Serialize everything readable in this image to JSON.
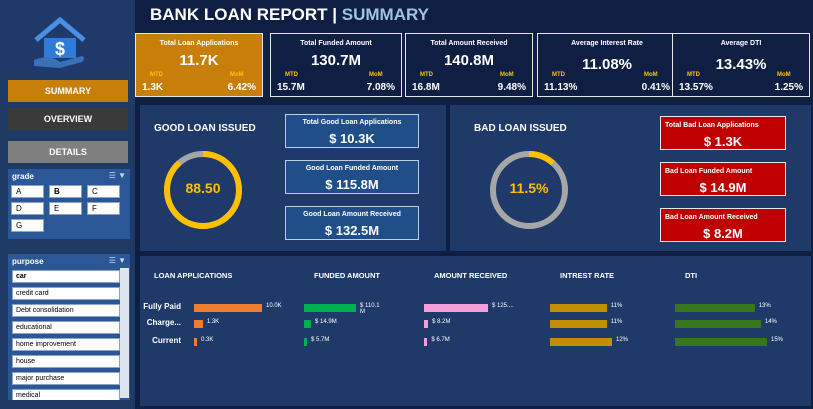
{
  "header": {
    "title": "BANK LOAN REPORT | ",
    "subtitle": "SUMMARY"
  },
  "icons": {
    "logo": "house-dollar-hand-icon",
    "filter": "filter-icon",
    "multiselect": "multi-select-icon"
  },
  "colors": {
    "accent": "#c87f0a",
    "kpi_gold": "#ffc000",
    "good": "#2e5fa0",
    "bad": "#c00000",
    "orange_bar": "#ed7d31",
    "green_bar": "#00b050",
    "pink_bar": "#f4a0d8",
    "gold_bar": "#bf8f00",
    "dti_bar": "#38761d"
  },
  "nav": {
    "summary": "SUMMARY",
    "overview": "OVERVIEW",
    "details": "DETAILS"
  },
  "grade": {
    "title": "grade",
    "options": [
      "A",
      "B",
      "C",
      "D",
      "E",
      "F",
      "G"
    ],
    "selected": "B"
  },
  "purpose": {
    "title": "purpose",
    "options": [
      "car",
      "credit card",
      "Debt consolidation",
      "educational",
      "home improvement",
      "house",
      "major purchase",
      "medical"
    ]
  },
  "kpis": [
    {
      "label": "Total Loan Applications",
      "value": "11.7K",
      "mtd_label": "MTD",
      "mom_label": "MoM",
      "mtd": "1.3K",
      "mom": "6.42%"
    },
    {
      "label": "Total Funded Amount",
      "value": "130.7M",
      "mtd_label": "MTD",
      "mom_label": "MoM",
      "mtd": "15.7M",
      "mom": "7.08%"
    },
    {
      "label": "Total Amount Received",
      "value": "140.8M",
      "mtd_label": "MTD",
      "mom_label": "MoM",
      "mtd": "16.8M",
      "mom": "9.48%"
    },
    {
      "label": "Average Interest Rate",
      "value": "11.08%",
      "mtd_label": "MTD",
      "mom_label": "MoM",
      "mtd": "11.13%",
      "mom": "0.41%"
    },
    {
      "label": "Average  DTI",
      "value": "13.43%",
      "mtd_label": "MTD",
      "mom_label": "MoM",
      "mtd": "13.57%",
      "mom": "1.25%"
    }
  ],
  "good": {
    "title": "GOOD LOAN ISSUED",
    "percent": "88.50",
    "fraction": 0.885,
    "cards": [
      {
        "label": "Total Good  Loan Applications",
        "value": "$ 10.3K"
      },
      {
        "label": "Good Loan Funded Amount",
        "value": "$ 115.8M"
      },
      {
        "label": "Good Loan  Amount Received",
        "value": "$ 132.5M"
      }
    ]
  },
  "bad": {
    "title": "BAD LOAN ISSUED",
    "percent": "11.5%",
    "fraction": 0.115,
    "cards": [
      {
        "label": "Total Bad  Loan Applications",
        "value": "$ 1.3K"
      },
      {
        "label": "Bad Loan Funded Amount",
        "value": "$ 14.9M"
      },
      {
        "label": "Bad Loan  Amount Received",
        "value": "$ 8.2M"
      }
    ]
  },
  "chart_data": [
    {
      "type": "bar",
      "title": "LOAN APPLICATIONS",
      "categories": [
        "Fully Paid",
        "Charge...",
        "Current"
      ],
      "values": [
        10.0,
        1.3,
        0.3
      ],
      "data_labels": [
        "10.0K",
        "1.3K",
        "0.3K"
      ]
    },
    {
      "type": "bar",
      "title": "FUNDED  AMOUNT",
      "categories": [
        "Fully Paid",
        "Charge...",
        "Current"
      ],
      "values": [
        110.1,
        14.9,
        5.7
      ],
      "data_labels": [
        "$ 110.1 M",
        "$ 14.9M",
        "$ 5.7M"
      ]
    },
    {
      "type": "bar",
      "title": "AMOUNT RECEIVED",
      "categories": [
        "Fully Paid",
        "Charge...",
        "Current"
      ],
      "values": [
        125.9,
        8.2,
        6.7
      ],
      "data_labels": [
        "$ 125....",
        "$ 8.2M",
        "$ 6.7M"
      ]
    },
    {
      "type": "bar",
      "title": "INTREST RATE",
      "categories": [
        "Fully Paid",
        "Charge...",
        "Current"
      ],
      "values": [
        11,
        11,
        12
      ],
      "data_labels": [
        "11%",
        "11%",
        "12%"
      ]
    },
    {
      "type": "bar",
      "title": "DTI",
      "categories": [
        "Fully Paid",
        "Charge...",
        "Current"
      ],
      "values": [
        13,
        14,
        15
      ],
      "data_labels": [
        "13%",
        "14%",
        "15%"
      ]
    }
  ]
}
